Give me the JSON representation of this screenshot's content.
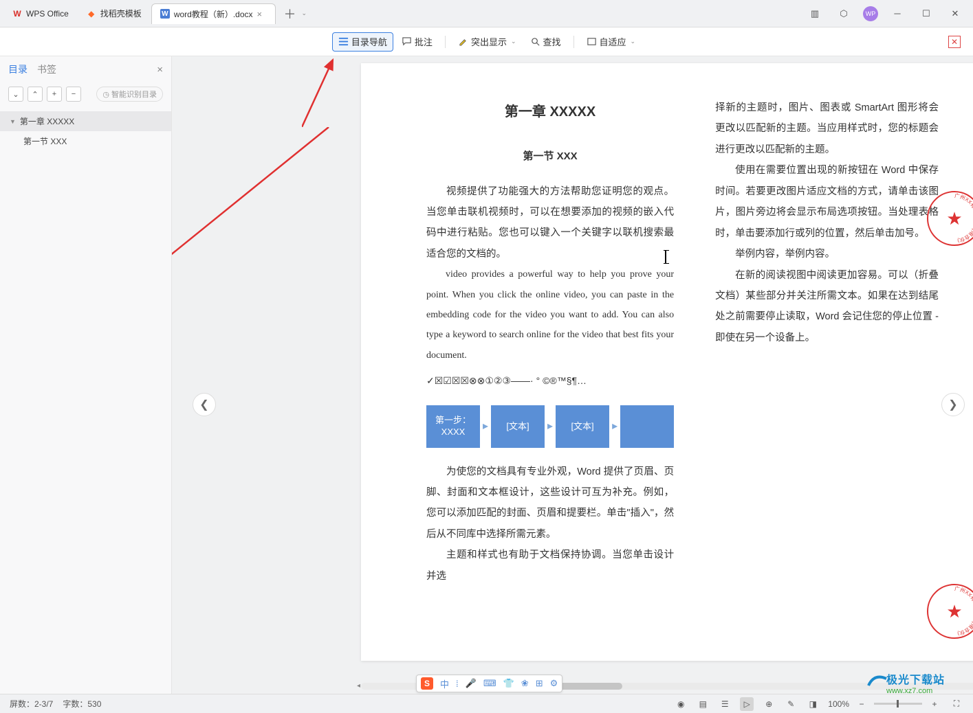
{
  "titlebar": {
    "tabs": [
      {
        "label": "WPS Office",
        "icon_color": "#d9302a",
        "letter": "W"
      },
      {
        "label": "找稻壳模板",
        "icon_color": "#ff6a2a",
        "letter": "◆"
      },
      {
        "label": "word教程（新）.docx",
        "icon_color": "#4a7dd4",
        "letter": "W",
        "active": true
      }
    ],
    "avatar": "WP",
    "layout_icon": "⊞",
    "cube_icon": "⬡"
  },
  "toolbar": {
    "catalog": "目录导航",
    "comment": "批注",
    "highlight": "突出显示",
    "find": "查找",
    "fit": "自适应"
  },
  "sidebar": {
    "tab_toc": "目录",
    "tab_bookmark": "书签",
    "smart": "智能识别目录",
    "toc": [
      {
        "label": "第一章 XXXXX",
        "level": 0,
        "selected": true
      },
      {
        "label": "第一节 XXX",
        "level": 1
      }
    ]
  },
  "doc": {
    "heading1": "第一章 XXXXX",
    "heading2": "第一节 XXX",
    "col1": {
      "p1": "视频提供了功能强大的方法帮助您证明您的观点。当您单击联机视频时，可以在想要添加的视频的嵌入代码中进行粘贴。您也可以键入一个关键字以联机搜索最适合您的文档的。",
      "p2": "video provides a powerful way to help you prove your point. When you click the online video, you can paste in the embedding code for the video you want to add. You can also type a keyword to search online for the video that best fits your document.",
      "symbols": "✓☒☑☒☒⊗⊗①②③——·   °  ©®™§¶…",
      "smartart": [
        "第一步：XXXX",
        "[文本]",
        "[文本]",
        ""
      ],
      "p3": "为使您的文档具有专业外观，Word 提供了页眉、页脚、封面和文本框设计，这些设计可互为补充。例如，您可以添加匹配的封面、页眉和提要栏。单击\"插入\"，然后从不同库中选择所需元素。",
      "p4": "主题和样式也有助于文档保持协调。当您单击设计并选"
    },
    "col2": {
      "p1": "择新的主题时，图片、图表或 SmartArt 图形将会更改以匹配新的主题。当应用样式时，您的标题会进行更改以匹配新的主题。",
      "p2": "使用在需要位置出现的新按钮在 Word 中保存时间。若要更改图片适应文档的方式，请单击该图片，图片旁边将会显示布局选项按钮。当处理表格时，单击要添加行或列的位置，然后单击加号。",
      "p3": "举例内容，举例内容。",
      "p4": "在新的阅读视图中阅读更加容易。可以（折叠文档）某些部分并关注所需文本。如果在达到结尾处之前需要停止读取，Word 会记住您的停止位置 - 即使在另一个设备上。"
    },
    "stamp_text": "广州XX有限公司(有限合伙)"
  },
  "ime": {
    "lang": "中",
    "icons": [
      "⁞",
      "🎤",
      "⌨",
      "👕",
      "❀",
      "⊞",
      "⚙"
    ]
  },
  "status": {
    "page": "屏数：2-3/7",
    "words": "字数：530",
    "zoom": "100%"
  },
  "watermark": {
    "line1": "极光下载站",
    "line2": "www.xz7.com"
  }
}
